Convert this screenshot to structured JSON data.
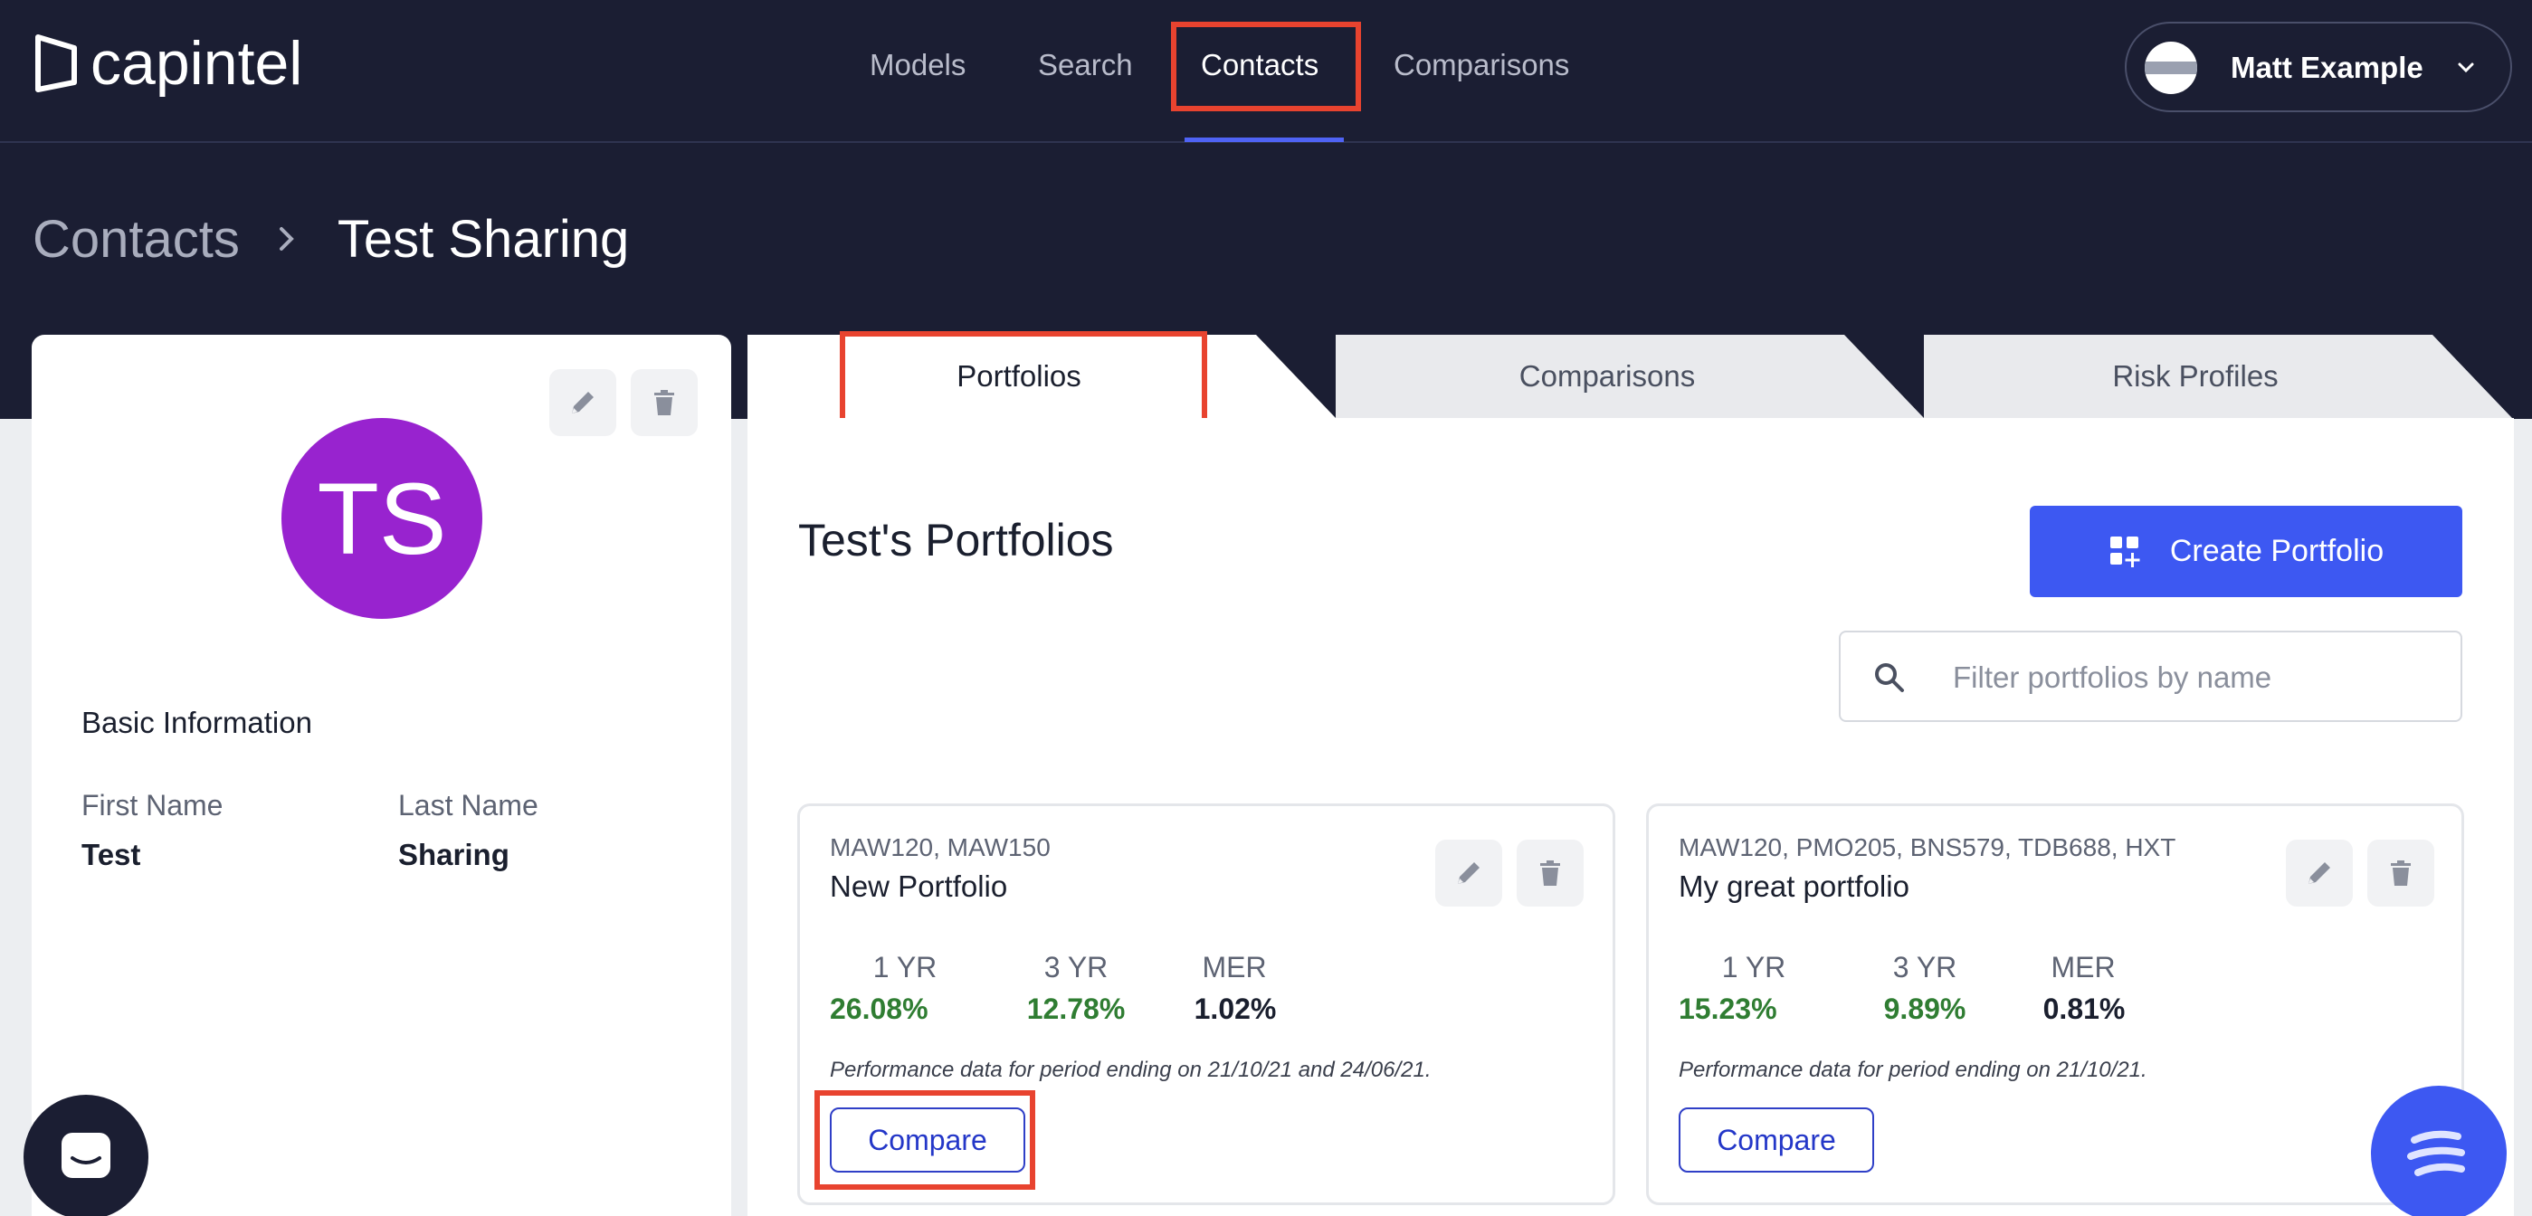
{
  "app": {
    "logo_text": "capintel"
  },
  "nav": {
    "items": [
      {
        "label": "Models"
      },
      {
        "label": "Search"
      },
      {
        "label": "Contacts"
      },
      {
        "label": "Comparisons"
      }
    ],
    "active": "Contacts"
  },
  "user": {
    "name": "Matt Example"
  },
  "breadcrumb": {
    "parent": "Contacts",
    "current": "Test Sharing"
  },
  "contact": {
    "initials": "TS",
    "avatar_color": "#9823cf",
    "section_title": "Basic Information",
    "first_name_label": "First Name",
    "first_name": "Test",
    "last_name_label": "Last Name",
    "last_name": "Sharing"
  },
  "tabs": [
    {
      "label": "Portfolios",
      "active": true
    },
    {
      "label": "Comparisons",
      "active": false
    },
    {
      "label": "Risk Profiles",
      "active": false
    }
  ],
  "main": {
    "heading": "Test's Portfolios",
    "create_label": "Create Portfolio",
    "filter_placeholder": "Filter portfolios by name"
  },
  "portfolios": [
    {
      "codes": "MAW120, MAW150",
      "name": "New Portfolio",
      "metrics": [
        {
          "label": "1 YR",
          "value": "26.08%",
          "tone": "green"
        },
        {
          "label": "3 YR",
          "value": "12.78%",
          "tone": "green"
        },
        {
          "label": "MER",
          "value": "1.02%",
          "tone": "dark"
        }
      ],
      "note": "Performance data for period ending on 21/10/21 and 24/06/21.",
      "compare_label": "Compare"
    },
    {
      "codes": "MAW120, PMO205, BNS579, TDB688, HXT",
      "name": "My great portfolio",
      "metrics": [
        {
          "label": "1 YR",
          "value": "15.23%",
          "tone": "green"
        },
        {
          "label": "3 YR",
          "value": "9.89%",
          "tone": "green"
        },
        {
          "label": "MER",
          "value": "0.81%",
          "tone": "dark"
        }
      ],
      "note": "Performance data for period ending on 21/10/21.",
      "compare_label": "Compare"
    }
  ],
  "colors": {
    "navy": "#1b1e33",
    "accent": "#3d58f2",
    "highlight": "#e8432f",
    "positive": "#2f7d32"
  }
}
